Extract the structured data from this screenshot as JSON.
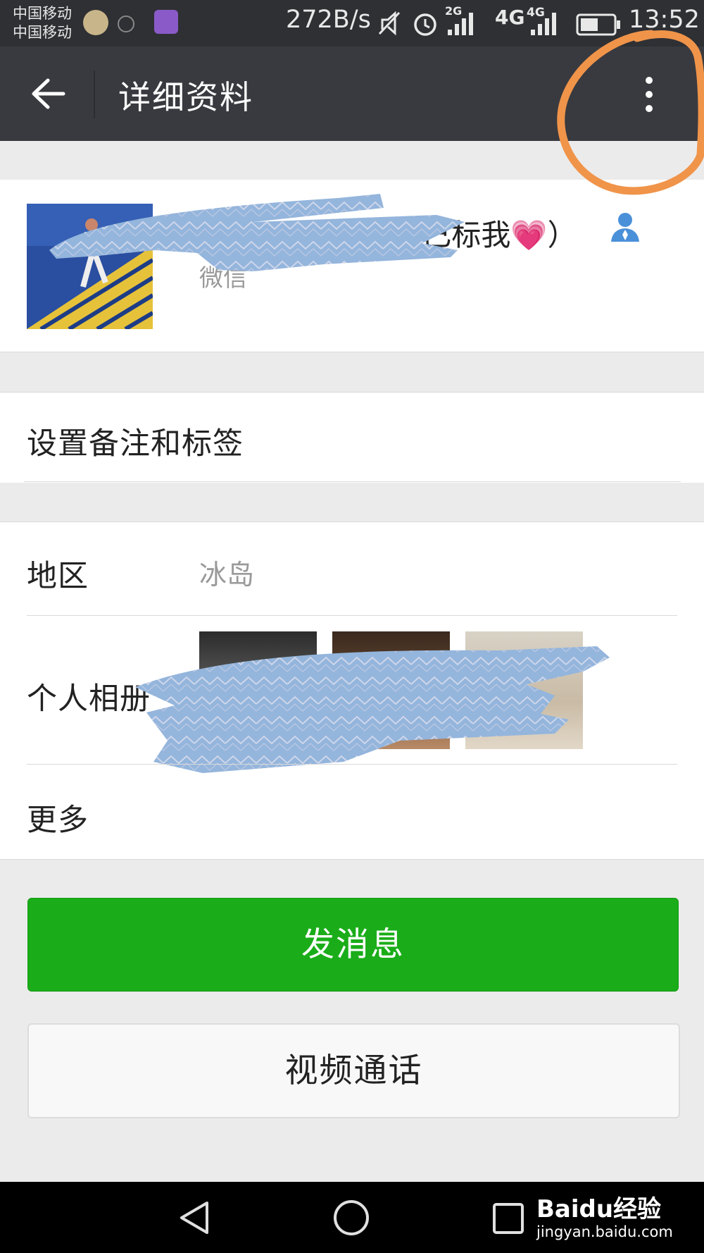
{
  "status_bar": {
    "carrier_1": "中国移动",
    "carrier_2": "中国移动",
    "network_speed": "272B/s",
    "network_2g": "2G",
    "network_4g_a": "4G",
    "network_4g_b": "4G",
    "time": "13:52"
  },
  "title_bar": {
    "title": "详细资料",
    "back_icon": "arrow-left-icon",
    "more_icon": "vertical-dots-icon"
  },
  "profile": {
    "nickname_visible": "(已标我💗）",
    "wechat_id_visible": "微信"
  },
  "rows": {
    "remark_label": "设置备注和标签",
    "region_label": "地区",
    "region_value": "冰岛",
    "album_label": "个人相册",
    "more_label": "更多"
  },
  "buttons": {
    "send_message": "发消息",
    "video_call": "视频通话"
  },
  "watermark": {
    "brand": "Baidu经验",
    "url": "jingyan.baidu.com"
  },
  "colors": {
    "status_bar": "#2f3034",
    "title_bar": "#393a3f",
    "primary_green": "#1aad19",
    "contact_icon_blue": "#4a90d9",
    "annotation_orange": "#f0944a",
    "redaction_blue": "#94b5dc"
  }
}
